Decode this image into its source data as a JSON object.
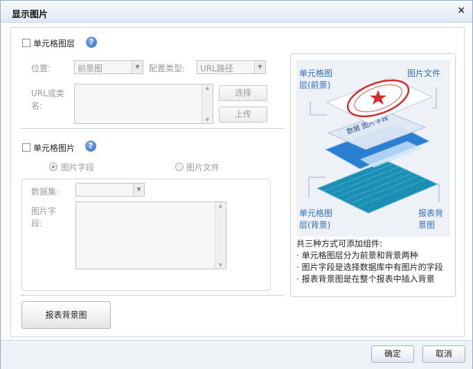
{
  "dialog": {
    "title": "显示图片",
    "close_glyph": "×"
  },
  "cell_layer": {
    "checkbox_label": "单元格图层",
    "help_glyph": "?",
    "position_label": "位置:",
    "position_value": "前景图",
    "config_type_label": "配置类型:",
    "config_type_value": "URL路径",
    "url_label_line1": "URL或类",
    "url_label_line2": "名:",
    "select_button": "选择",
    "upload_button": "上传"
  },
  "cell_image": {
    "checkbox_label": "单元格图片",
    "help_glyph": "?",
    "radio_field_label": "图片字段",
    "radio_file_label": "图片文件",
    "dataset_label": "数据集:",
    "dataset_value": "",
    "image_field_label_line1": "图片字",
    "image_field_label_line2": "段:"
  },
  "report_bg_button": "报表背景图",
  "illustration": {
    "top_left_line1": "单元格图",
    "top_left_line2": "层(前景)",
    "top_right": "图片文件",
    "bottom_left_line1": "单元格图",
    "bottom_left_line2": "层(背景)",
    "bottom_right_line1": "报表背",
    "bottom_right_line2": "景图",
    "layer_text": "数据 图片字段"
  },
  "description": {
    "heading": "共三种方式可添加组件:",
    "items": [
      "· 单元格图层分为前景和背景两种",
      "· 图片字段是选择数据库中有图片的字段",
      "· 报表背景图是在整个报表中插入背景"
    ]
  },
  "footer": {
    "ok_button": "确定",
    "cancel_button": "取消"
  },
  "icons": {
    "close": "close-icon",
    "help": "help-icon",
    "dropdown": "chevron-down-icon",
    "scroll_up": "scroll-up-icon",
    "scroll_down": "scroll-down-icon"
  },
  "colors": {
    "accent_text": "#2f6fc0",
    "title_bar": "#dfe8f3",
    "disabled_text": "#9a9a9a"
  }
}
